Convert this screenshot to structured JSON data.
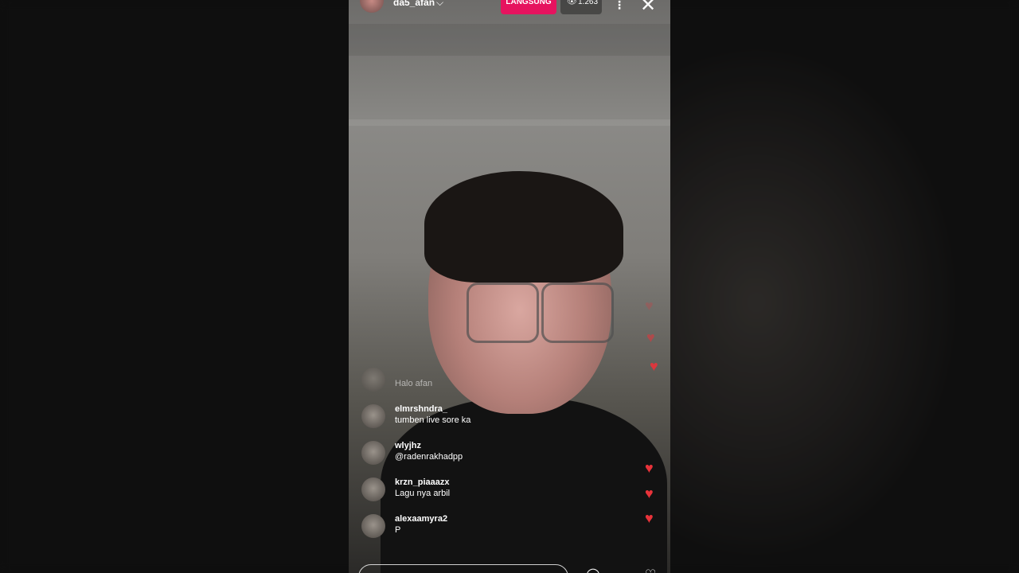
{
  "host": {
    "username": "da5_afan"
  },
  "live": {
    "badge": "LANGSUNG",
    "viewers": "1.263"
  },
  "icons": {
    "viewers": "eye-icon",
    "menu": "more-vertical-icon",
    "close": "close-icon",
    "heart": "heart-icon"
  },
  "comments": [
    {
      "user": "",
      "text": "Halo afan"
    },
    {
      "user": "elmrshndra_",
      "text": "tumben live sore ka"
    },
    {
      "user": "wlyjhz",
      "text": "@radenrakhadpp"
    },
    {
      "user": "krzn_piaaazx",
      "text": "Lagu nya arbil"
    },
    {
      "user": "alexaamyra2",
      "text": "P"
    }
  ],
  "colors": {
    "live_badge": "#e6135f",
    "heart": "#e8333a"
  }
}
